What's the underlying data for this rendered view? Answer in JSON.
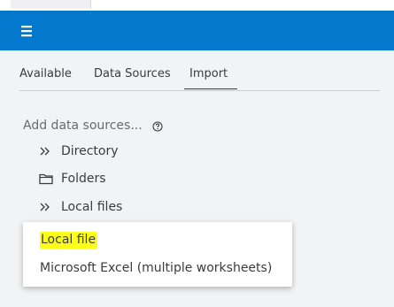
{
  "header": {
    "menu_icon": "hamburger-menu-icon",
    "brand_color": "#0378cd"
  },
  "tabs": [
    {
      "label": "Available"
    },
    {
      "label": "Data Sources"
    },
    {
      "label": "Import",
      "selected": true
    }
  ],
  "section": {
    "title": "Add data sources...",
    "help_icon": "help-circle-icon"
  },
  "tree": [
    {
      "icon": "double-chevron-right-icon",
      "label": "Directory"
    },
    {
      "icon": "folder-icon",
      "label": "Folders"
    },
    {
      "icon": "double-chevron-right-icon",
      "label": "Local files"
    }
  ],
  "dropdown": {
    "items": [
      {
        "label": "Local file",
        "highlight_color": "#ffff1a"
      },
      {
        "label": "Microsoft Excel (multiple worksheets)"
      }
    ]
  }
}
